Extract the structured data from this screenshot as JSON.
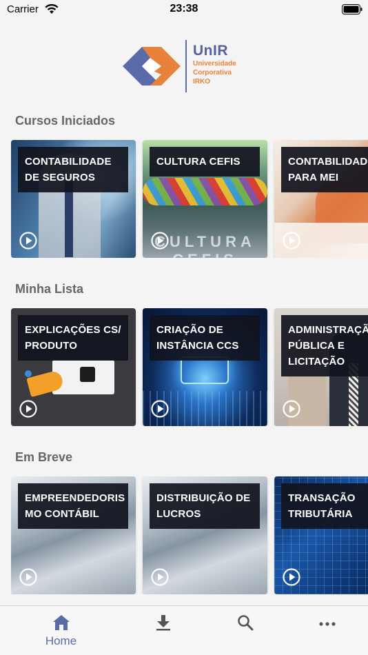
{
  "status_bar": {
    "carrier": "Carrier",
    "time": "23:38"
  },
  "logo": {
    "title": "UnIR",
    "subtitle_lines": [
      "Universidade",
      "Corporativa",
      "IRKO"
    ],
    "colors": {
      "blue": "#5b6aa8",
      "orange": "#e8823a"
    }
  },
  "sections": [
    {
      "title": "Cursos Iniciados",
      "cards": [
        {
          "label": "CONTABILIDADE DE SEGUROS",
          "image": "businessman-digital",
          "play_icon": "play-circle-icon"
        },
        {
          "label": "CULTURA CEFIS",
          "image": "colorful-braid",
          "play_icon": "play-circle-icon"
        },
        {
          "label": "CONTABILIDADE PARA MEI",
          "image": "office-paperwork",
          "play_icon": "play-circle-icon"
        }
      ]
    },
    {
      "title": "Minha Lista",
      "cards": [
        {
          "label": "EXPLICAÇÕES CS/ PRODUTO",
          "image": "megaphone-laptop",
          "play_icon": "play-circle-icon"
        },
        {
          "label": "CRIAÇÃO DE INSTÂNCIA CCS",
          "image": "circuit-chip",
          "play_icon": "play-circle-icon"
        },
        {
          "label": "ADMINISTRAÇÃO PÚBLICA E LICITAÇÃO",
          "image": "business-people",
          "play_icon": "play-circle-icon"
        }
      ]
    },
    {
      "title": "Em Breve",
      "cards": [
        {
          "label": "EMPREENDEDORIS MO CONTÁBIL",
          "image": "blurred-paper",
          "play_icon": "play-circle-icon"
        },
        {
          "label": "DISTRIBUIÇÃO DE LUCROS",
          "image": "blurred-paper",
          "play_icon": "play-circle-icon"
        },
        {
          "label": "TRANSAÇÃO TRIBUTÁRIA",
          "image": "blue-finance-chart",
          "play_icon": "play-circle-icon"
        }
      ]
    }
  ],
  "tab_bar": {
    "tabs": [
      {
        "label": "Home",
        "icon": "house-icon",
        "active": true
      },
      {
        "label": "",
        "icon": "download-icon",
        "active": false
      },
      {
        "label": "",
        "icon": "search-icon",
        "active": false
      },
      {
        "label": "",
        "icon": "more-icon",
        "active": false
      }
    ],
    "active_color": "#5a6aa6",
    "inactive_color": "#555555"
  }
}
